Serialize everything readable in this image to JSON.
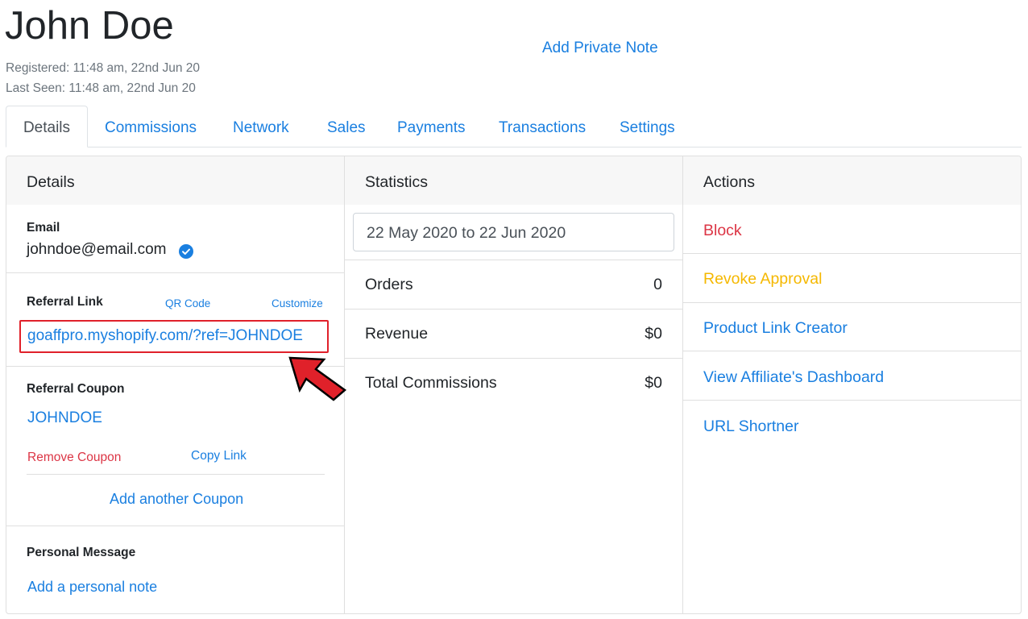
{
  "header": {
    "name": "John Doe",
    "registered": "Registered: 11:48 am, 22nd Jun 20",
    "last_seen": "Last Seen: 11:48 am, 22nd Jun 20",
    "add_private_note": "Add Private Note"
  },
  "tabs": [
    {
      "label": "Details",
      "active": true
    },
    {
      "label": "Commissions",
      "active": false
    },
    {
      "label": "Network",
      "active": false
    },
    {
      "label": "Sales",
      "active": false
    },
    {
      "label": "Payments",
      "active": false
    },
    {
      "label": "Transactions",
      "active": false
    },
    {
      "label": "Settings",
      "active": false
    }
  ],
  "details": {
    "heading": "Details",
    "email_label": "Email",
    "email": "johndoe@email.com",
    "email_verified_icon": "check-circle-icon",
    "referral_link_label": "Referral Link",
    "qr_code": "QR Code",
    "customize": "Customize",
    "referral_link": "goaffpro.myshopify.com/?ref=JOHNDOE",
    "referral_coupon_label": "Referral Coupon",
    "coupon": "JOHNDOE",
    "remove_coupon": "Remove Coupon",
    "copy_link": "Copy Link",
    "add_another_coupon": "Add another Coupon",
    "personal_message_label": "Personal Message",
    "add_personal_note": "Add a personal note"
  },
  "statistics": {
    "heading": "Statistics",
    "date_range": "22 May 2020 to 22 Jun 2020",
    "rows": [
      {
        "label": "Orders",
        "value": "0"
      },
      {
        "label": "Revenue",
        "value": "$0"
      },
      {
        "label": "Total Commissions",
        "value": "$0"
      }
    ]
  },
  "actions": {
    "heading": "Actions",
    "items": [
      {
        "label": "Block",
        "color": "#dc3545"
      },
      {
        "label": "Revoke Approval",
        "color": "#f5b800"
      },
      {
        "label": "Product Link Creator",
        "color": "#1a7fe0"
      },
      {
        "label": "View Affiliate's Dashboard",
        "color": "#1a7fe0"
      },
      {
        "label": "URL Shortner",
        "color": "#1a7fe0"
      }
    ]
  },
  "annotation": {
    "arrow_color": "#e0212a",
    "highlight_color": "#e0212a"
  }
}
